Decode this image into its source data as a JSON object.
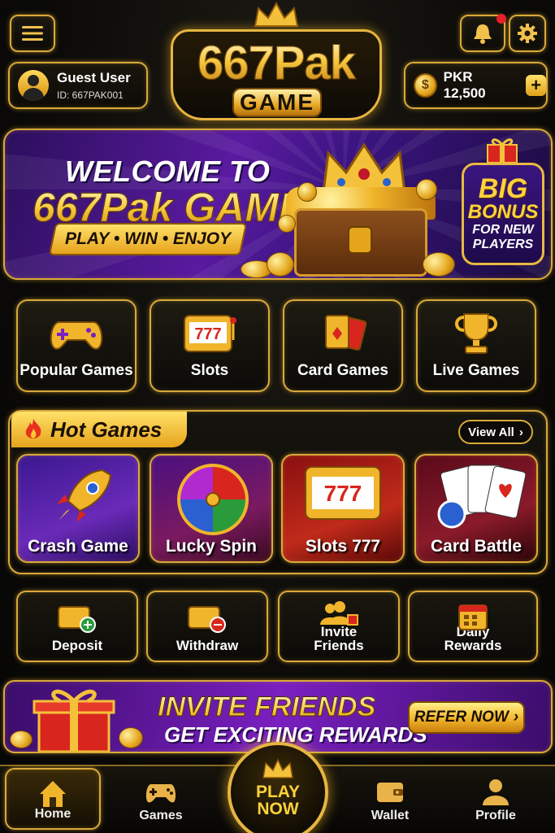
{
  "header": {
    "logo_title": "667Pak",
    "logo_sub": "GAME",
    "user_name": "Guest User",
    "user_id": "ID: 667PAK001",
    "balance": "PKR 12,500",
    "coin_symbol": "$",
    "plus": "+"
  },
  "banner": {
    "welcome": "WELCOME TO",
    "name": "667Pak GAME",
    "tagline": "PLAY • WIN • ENJOY",
    "bonus_big": "BIG",
    "bonus_bonus": "BONUS",
    "bonus_small": "FOR NEW PLAYERS"
  },
  "categories": [
    {
      "label": "Popular Games",
      "icon": "gamepad-icon"
    },
    {
      "label": "Slots",
      "icon": "slot-machine-icon"
    },
    {
      "label": "Card Games",
      "icon": "playing-cards-icon"
    },
    {
      "label": "Live Games",
      "icon": "trophy-icon"
    }
  ],
  "hot_games": {
    "title": "Hot Games",
    "view_all": "View All",
    "games": [
      {
        "label": "Crash Game"
      },
      {
        "label": "Lucky Spin"
      },
      {
        "label": "Slots 777"
      },
      {
        "label": "Card Battle"
      }
    ]
  },
  "actions": [
    {
      "label": "Deposit"
    },
    {
      "label": "Withdraw"
    },
    {
      "label": "Invite Friends"
    },
    {
      "label": "Daily Rewards"
    }
  ],
  "invite": {
    "line1": "INVITE FRIENDS",
    "line2": "GET EXCITING REWARDS",
    "button": "REFER NOW"
  },
  "nav": {
    "home": "Home",
    "games": "Games",
    "play_now": "PLAY NOW",
    "wallet": "Wallet",
    "profile": "Profile"
  },
  "colors": {
    "gold": "#e7b541",
    "background": "#0b0a08",
    "purple": "#5a1aa0"
  }
}
